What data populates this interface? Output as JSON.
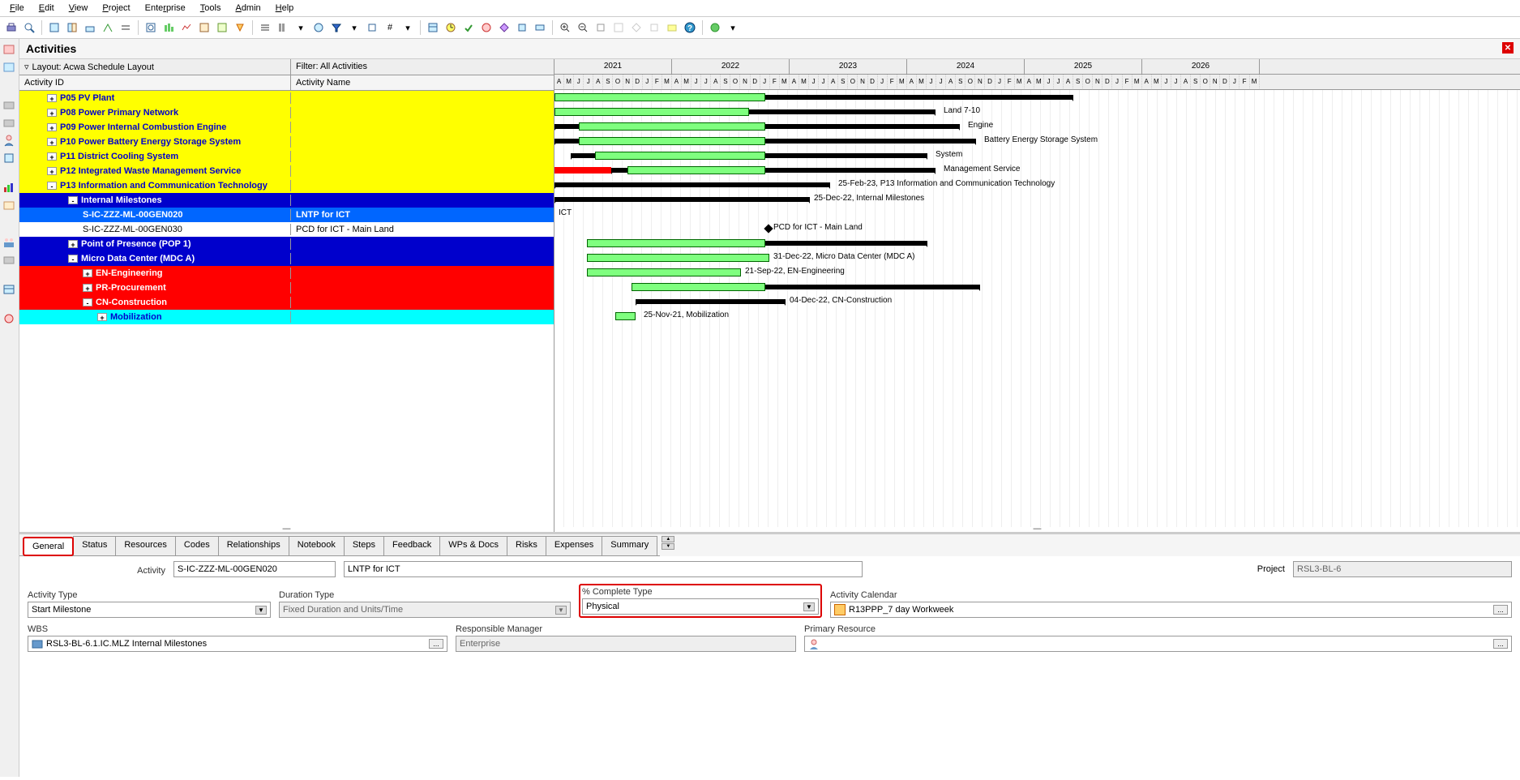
{
  "menu": {
    "items": [
      "File",
      "Edit",
      "View",
      "Project",
      "Enterprise",
      "Tools",
      "Admin",
      "Help"
    ]
  },
  "title": "Activities",
  "layout_label": "Layout: Acwa Schedule Layout",
  "filter_label": "Filter: All Activities",
  "col_id": "Activity ID",
  "col_name": "Activity Name",
  "years": [
    "2021",
    "2022",
    "2023",
    "2024",
    "2025",
    "2026"
  ],
  "months_cycle": [
    "A",
    "M",
    "J",
    "J",
    "A",
    "S",
    "O",
    "N",
    "D",
    "J",
    "F",
    "M"
  ],
  "rows": [
    {
      "id": "P05 PV Plant",
      "name": "",
      "cls": "lvl-yellow",
      "indent": 1,
      "exp": "+",
      "strips": [
        "green",
        "yellow"
      ],
      "label": "",
      "lblx": 640
    },
    {
      "id": "P08 Power Primary Network",
      "name": "",
      "cls": "lvl-yellow",
      "indent": 1,
      "exp": "+",
      "strips": [
        "green",
        "yellow"
      ],
      "label": "Land 7-10",
      "lblx": 480
    },
    {
      "id": "P09 Power Internal Combustion Engine",
      "name": "",
      "cls": "lvl-yellow",
      "indent": 1,
      "exp": "+",
      "strips": [
        "green",
        "yellow"
      ],
      "label": "Engine",
      "lblx": 510
    },
    {
      "id": "P10 Power Battery Energy Storage System",
      "name": "",
      "cls": "lvl-yellow",
      "indent": 1,
      "exp": "+",
      "strips": [
        "green",
        "yellow"
      ],
      "label": "Battery Energy Storage System",
      "lblx": 530
    },
    {
      "id": "P11 District Cooling System",
      "name": "",
      "cls": "lvl-yellow",
      "indent": 1,
      "exp": "+",
      "strips": [
        "green",
        "yellow"
      ],
      "label": "System",
      "lblx": 470
    },
    {
      "id": "P12 Integrated Waste Management Service",
      "name": "",
      "cls": "lvl-yellow",
      "indent": 1,
      "exp": "+",
      "strips": [
        "green",
        "yellow"
      ],
      "label": "Management Service",
      "lblx": 480
    },
    {
      "id": "P13 Information and Communication Technology",
      "name": "",
      "cls": "lvl-yellow",
      "indent": 1,
      "exp": "-",
      "strips": [
        "green",
        "yellow"
      ],
      "label": "25-Feb-23, P13 Information and Communication Technology",
      "lblx": 350
    },
    {
      "id": "Internal Milestones",
      "name": "",
      "cls": "lvl-blue",
      "indent": 2,
      "exp": "-",
      "strips": [
        "green",
        "yellow",
        "blue"
      ],
      "label": "25-Dec-22, Internal Milestones",
      "lblx": 320
    },
    {
      "id": "S-IC-ZZZ-ML-00GEN020",
      "name": "LNTP for ICT",
      "cls": "lvl-blue-sel",
      "indent": 3,
      "exp": "",
      "strips": [
        "green",
        "yellow",
        "blue"
      ],
      "label": "ICT",
      "lblx": 5
    },
    {
      "id": "S-IC-ZZZ-ML-00GEN030",
      "name": "PCD for ICT - Main Land",
      "cls": "lvl-white",
      "indent": 3,
      "exp": "",
      "strips": [
        "green",
        "yellow",
        "blue"
      ],
      "label": "PCD for ICT - Main Land",
      "lblx": 270,
      "diamond": 260
    },
    {
      "id": "Point of Presence (POP 1)",
      "name": "",
      "cls": "lvl-blue",
      "indent": 2,
      "exp": "+",
      "strips": [
        "green",
        "yellow",
        "blue"
      ],
      "label": "",
      "lblx": 460
    },
    {
      "id": "Micro Data Center (MDC A)",
      "name": "",
      "cls": "lvl-blue",
      "indent": 2,
      "exp": "-",
      "strips": [
        "green",
        "yellow",
        "blue"
      ],
      "label": "31-Dec-22, Micro Data Center (MDC A)",
      "lblx": 270
    },
    {
      "id": "EN-Engineering",
      "name": "",
      "cls": "lvl-red",
      "indent": 3,
      "exp": "+",
      "strips": [
        "green",
        "yellow",
        "blue"
      ],
      "label": "21-Sep-22, EN-Engineering",
      "lblx": 235
    },
    {
      "id": "PR-Procurement",
      "name": "",
      "cls": "lvl-red",
      "indent": 3,
      "exp": "+",
      "strips": [
        "green",
        "yellow",
        "blue"
      ],
      "label": "",
      "lblx": 530
    },
    {
      "id": "CN-Construction",
      "name": "",
      "cls": "lvl-red",
      "indent": 3,
      "exp": "-",
      "strips": [
        "green",
        "yellow",
        "blue"
      ],
      "label": "04-Dec-22, CN-Construction",
      "lblx": 290
    },
    {
      "id": "Mobilization",
      "name": "",
      "cls": "lvl-cyan",
      "indent": 4,
      "exp": "+",
      "strips": [
        "green",
        "yellow",
        "blue"
      ],
      "label": "25-Nov-21, Mobilization",
      "lblx": 110
    }
  ],
  "detail_tabs": [
    "General",
    "Status",
    "Resources",
    "Codes",
    "Relationships",
    "Notebook",
    "Steps",
    "Feedback",
    "WPs & Docs",
    "Risks",
    "Expenses",
    "Summary"
  ],
  "detail": {
    "activity_label": "Activity",
    "activity_id": "S-IC-ZZZ-ML-00GEN020",
    "activity_name": "LNTP for ICT",
    "project_label": "Project",
    "project": "RSL3-BL-6",
    "activity_type_label": "Activity Type",
    "activity_type": "Start Milestone",
    "duration_type_label": "Duration Type",
    "duration_type": "Fixed Duration and Units/Time",
    "pct_complete_label": "% Complete Type",
    "pct_complete": "Physical",
    "calendar_label": "Activity Calendar",
    "calendar": "R13PPP_7 day Workweek",
    "wbs_label": "WBS",
    "wbs": "RSL3-BL-6.1.IC.MLZ  Internal Milestones",
    "resp_mgr_label": "Responsible Manager",
    "resp_mgr": "Enterprise",
    "primary_res_label": "Primary Resource",
    "primary_res": ""
  }
}
